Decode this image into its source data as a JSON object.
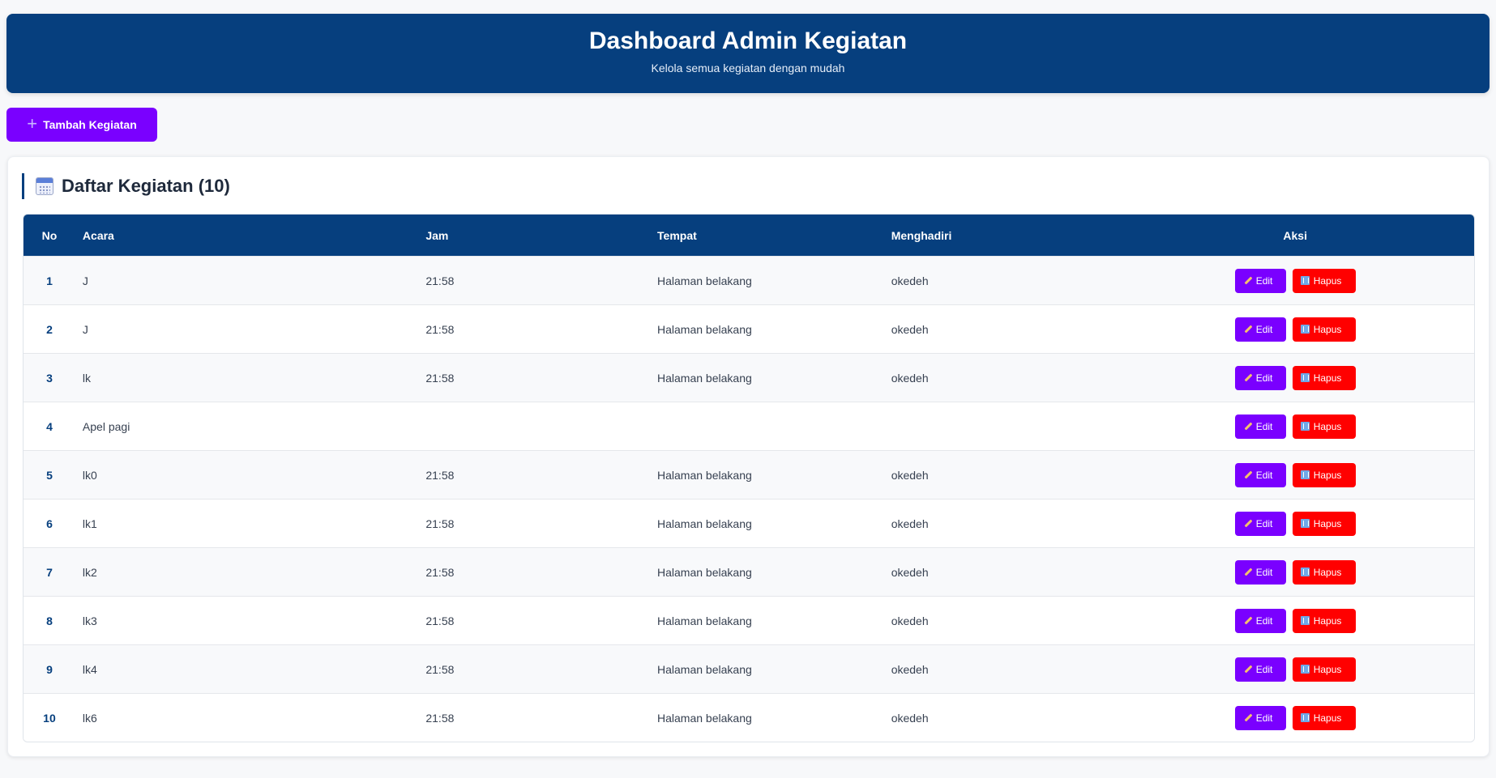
{
  "header": {
    "title": "Dashboard Admin Kegiatan",
    "subtitle": "Kelola semua kegiatan dengan mudah"
  },
  "add_button": {
    "icon": "plus-icon",
    "label": "Tambah Kegiatan"
  },
  "list": {
    "icon": "calendar-icon",
    "title": "Daftar Kegiatan (10)",
    "columns": [
      "No",
      "Acara",
      "Jam",
      "Tempat",
      "Menghadiri",
      "Aksi"
    ],
    "edit_label": "Edit",
    "delete_label": "Hapus",
    "rows": [
      {
        "no": "1",
        "acara": "J",
        "jam": "21:58",
        "tempat": "Halaman belakang",
        "menghadiri": "okedeh"
      },
      {
        "no": "2",
        "acara": "J",
        "jam": "21:58",
        "tempat": "Halaman belakang",
        "menghadiri": "okedeh"
      },
      {
        "no": "3",
        "acara": "lk",
        "jam": "21:58",
        "tempat": "Halaman belakang",
        "menghadiri": "okedeh"
      },
      {
        "no": "4",
        "acara": "Apel pagi",
        "jam": "",
        "tempat": "",
        "menghadiri": ""
      },
      {
        "no": "5",
        "acara": "lk0",
        "jam": "21:58",
        "tempat": "Halaman belakang",
        "menghadiri": "okedeh"
      },
      {
        "no": "6",
        "acara": "lk1",
        "jam": "21:58",
        "tempat": "Halaman belakang",
        "menghadiri": "okedeh"
      },
      {
        "no": "7",
        "acara": "lk2",
        "jam": "21:58",
        "tempat": "Halaman belakang",
        "menghadiri": "okedeh"
      },
      {
        "no": "8",
        "acara": "lk3",
        "jam": "21:58",
        "tempat": "Halaman belakang",
        "menghadiri": "okedeh"
      },
      {
        "no": "9",
        "acara": "lk4",
        "jam": "21:58",
        "tempat": "Halaman belakang",
        "menghadiri": "okedeh"
      },
      {
        "no": "10",
        "acara": "lk6",
        "jam": "21:58",
        "tempat": "Halaman belakang",
        "menghadiri": "okedeh"
      }
    ]
  },
  "colors": {
    "header_bg": "#063f7e",
    "primary_button": "#7a00ff",
    "danger_button": "#ff0000",
    "page_bg": "#f7f8fa"
  }
}
